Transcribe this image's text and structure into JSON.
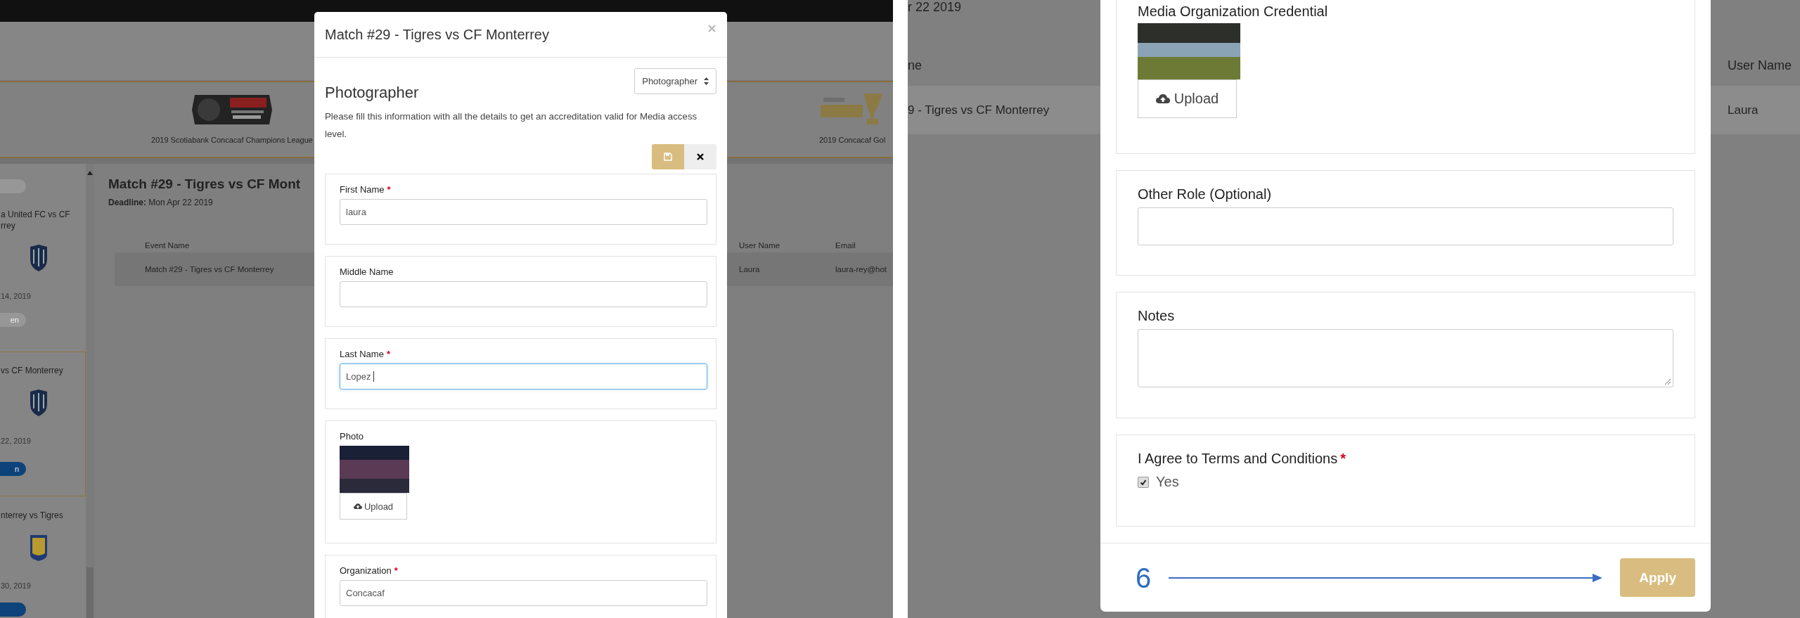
{
  "left_view": {
    "banner": {
      "captions": [
        "2019 Scotiabank Concacaf Champions League",
        "2019 Concacaf Gol"
      ]
    },
    "sidebar": {
      "cards": [
        {
          "selected": false,
          "button": {
            "kind": "muted"
          }
        },
        {
          "selected": false,
          "title_lines": [
            "a United FC vs CF",
            "rrey"
          ],
          "crest": {
            "kind": "striped"
          },
          "date": "14, 2019",
          "button": {
            "kind": "muted",
            "label": "en"
          }
        },
        {
          "selected": true,
          "title_lines": [
            "vs CF Monterrey"
          ],
          "crest": {
            "kind": "striped"
          },
          "date": "22, 2019",
          "button": {
            "kind": "primary",
            "label": "n"
          }
        },
        {
          "selected": false,
          "title_lines": [
            "nterrey vs Tigres"
          ],
          "crest": {
            "kind": "framed"
          },
          "date": "30, 2019",
          "button": {
            "kind": "primary"
          }
        }
      ]
    },
    "main": {
      "title": "Match #29 - Tigres vs CF Mont",
      "deadline": "**Deadline:** Mon Apr 22 2019",
      "table": {
        "columns": [
          "Event Name",
          "User Name",
          "Email"
        ],
        "rows": [
          {
            "cells": [
              "Match #29 - Tigres vs CF Monterrey",
              "Laura",
              "laura-rey@hot"
            ],
            "selected": true
          }
        ]
      }
    },
    "modal": {
      "title": "Match #29 - Tigres vs CF Monterrey",
      "role_select": "Photographer",
      "heading": "Photographer",
      "description": "Please fill this information with all the details to get an accreditation valid for Media access level.",
      "fields": [
        {
          "kind": "text",
          "label": "First Name",
          "required_mark": "*",
          "value": "laura",
          "focused": false
        },
        {
          "kind": "text",
          "label": "Middle Name",
          "focused": false
        },
        {
          "kind": "text",
          "label": "Last Name",
          "required_mark": "*",
          "value": "Lopez",
          "focused": true
        },
        {
          "kind": "photo",
          "label": "Photo",
          "button": "Upload"
        },
        {
          "kind": "text",
          "label": "Organization",
          "required_mark": "*",
          "value": "Concacaf",
          "focused": false
        }
      ]
    }
  },
  "right_view": {
    "background": {
      "date": "r 22 2019",
      "columns": [
        "ne",
        "User Name"
      ],
      "rows": [
        {
          "cells": [
            "9 - Tigres vs CF Monterrey",
            "Laura"
          ],
          "selected": true
        }
      ]
    },
    "modal": {
      "fields": [
        {
          "kind": "photo",
          "label": "Media Organization Credential",
          "button": "Upload"
        },
        {
          "kind": "text",
          "label": "Other Role (Optional)",
          "focused": false
        },
        {
          "kind": "textarea",
          "label": "Notes"
        },
        {
          "kind": "checkbox",
          "label": "I Agree to Terms and Conditions",
          "required_mark": "*",
          "option": "Yes",
          "checked": true
        }
      ],
      "annotation": "6",
      "button": "Apply"
    }
  }
}
